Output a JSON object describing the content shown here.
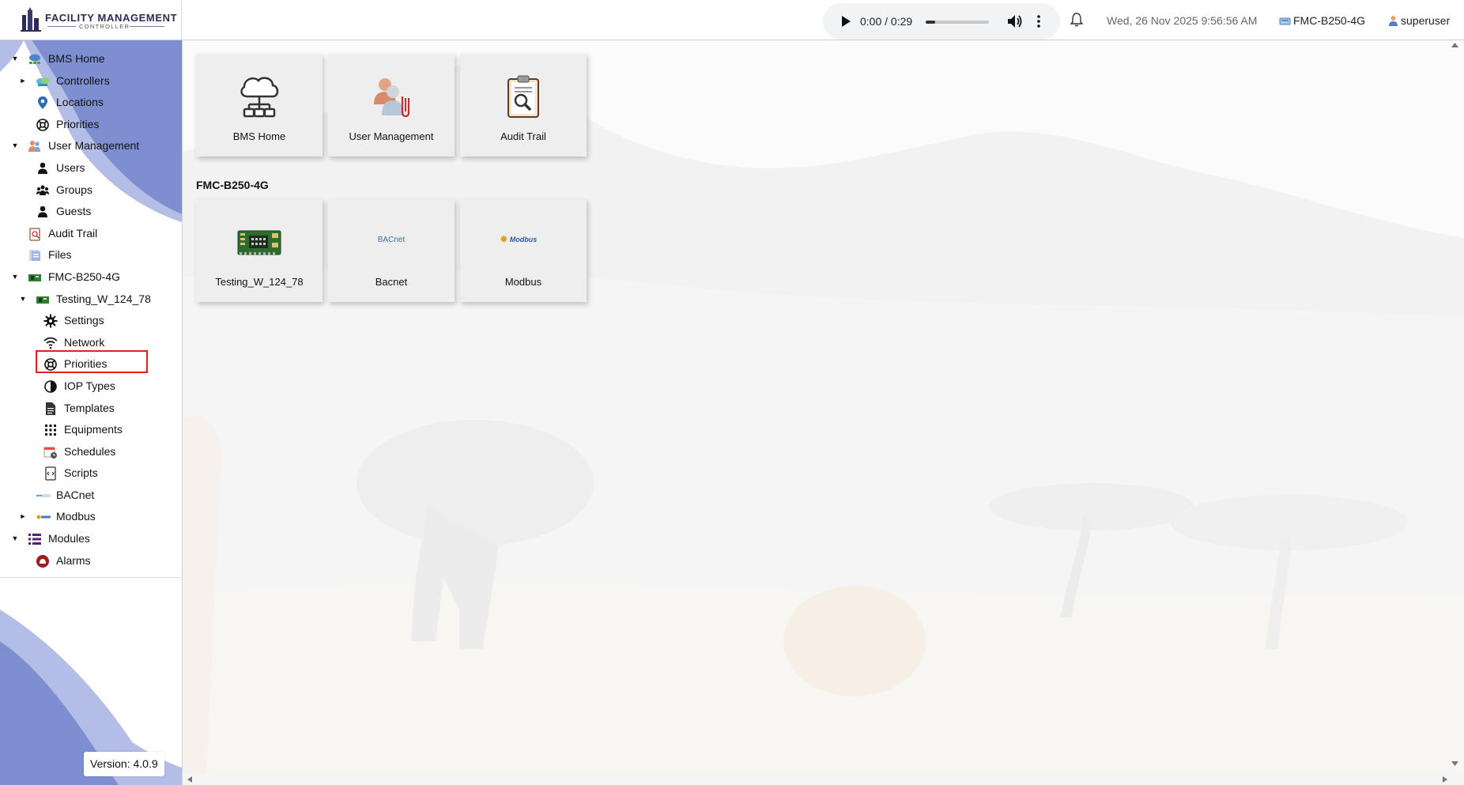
{
  "app": {
    "logo_title": "FACILITY MANAGEMENT",
    "logo_subtitle": "CONTROLLER",
    "version": "Version: 4.0.9"
  },
  "header": {
    "audio": {
      "time": "0:00 / 0:29",
      "progress": 0.0
    },
    "datetime": "Wed, 26 Nov 2025 9:56:56 AM",
    "device": "FMC-B250-4G",
    "user": "superuser"
  },
  "sidebar": {
    "items": [
      {
        "label": "BMS Home",
        "icon": "bms-home-icon",
        "caret": "▼"
      },
      {
        "label": "Controllers",
        "icon": "controllers-icon",
        "caret": "►"
      },
      {
        "label": "Locations",
        "icon": "location-pin-icon",
        "caret": ""
      },
      {
        "label": "Priorities",
        "icon": "lifebuoy-icon",
        "caret": ""
      },
      {
        "label": "User Management",
        "icon": "user-management-icon",
        "caret": "▼"
      },
      {
        "label": "Users",
        "icon": "user-icon",
        "caret": ""
      },
      {
        "label": "Groups",
        "icon": "groups-icon",
        "caret": ""
      },
      {
        "label": "Guests",
        "icon": "guest-icon",
        "caret": ""
      },
      {
        "label": "Audit Trail",
        "icon": "audit-trail-icon",
        "caret": ""
      },
      {
        "label": "Files",
        "icon": "files-icon",
        "caret": ""
      },
      {
        "label": "FMC-B250-4G",
        "icon": "fmc-device-icon",
        "caret": "▼"
      },
      {
        "label": "Testing_W_124_78",
        "icon": "circuit-board-icon",
        "caret": "▼"
      },
      {
        "label": "Settings",
        "icon": "gear-icon",
        "caret": ""
      },
      {
        "label": "Network",
        "icon": "wifi-icon",
        "caret": ""
      },
      {
        "label": "Priorities",
        "icon": "lifebuoy-icon",
        "caret": ""
      },
      {
        "label": "IOP Types",
        "icon": "half-circle-icon",
        "caret": ""
      },
      {
        "label": "Templates",
        "icon": "document-icon",
        "caret": ""
      },
      {
        "label": "Equipments",
        "icon": "grid-dots-icon",
        "caret": ""
      },
      {
        "label": "Schedules",
        "icon": "calendar-clock-icon",
        "caret": ""
      },
      {
        "label": "Scripts",
        "icon": "script-icon",
        "caret": ""
      },
      {
        "label": "BACnet",
        "icon": "bacnet-logo-icon",
        "caret": ""
      },
      {
        "label": "Modbus",
        "icon": "modbus-logo-icon",
        "caret": "►"
      },
      {
        "label": "Modules",
        "icon": "modules-list-icon",
        "caret": "▼"
      },
      {
        "label": "Alarms",
        "icon": "alarm-icon",
        "caret": ""
      }
    ]
  },
  "main": {
    "top_tiles": [
      {
        "label": "BMS Home",
        "icon": "cloud-network-icon"
      },
      {
        "label": "User Management",
        "icon": "users-clip-icon"
      },
      {
        "label": "Audit Trail",
        "icon": "clipboard-search-icon"
      }
    ],
    "section_heading": "FMC-B250-4G",
    "section_tiles": [
      {
        "label": "Testing_W_124_78",
        "icon": "circuit-board-icon"
      },
      {
        "label": "Bacnet",
        "icon": "bacnet-logo-icon",
        "logo_text": "BACnet"
      },
      {
        "label": "Modbus",
        "icon": "modbus-logo-icon",
        "logo_text": "Modbus"
      }
    ]
  }
}
